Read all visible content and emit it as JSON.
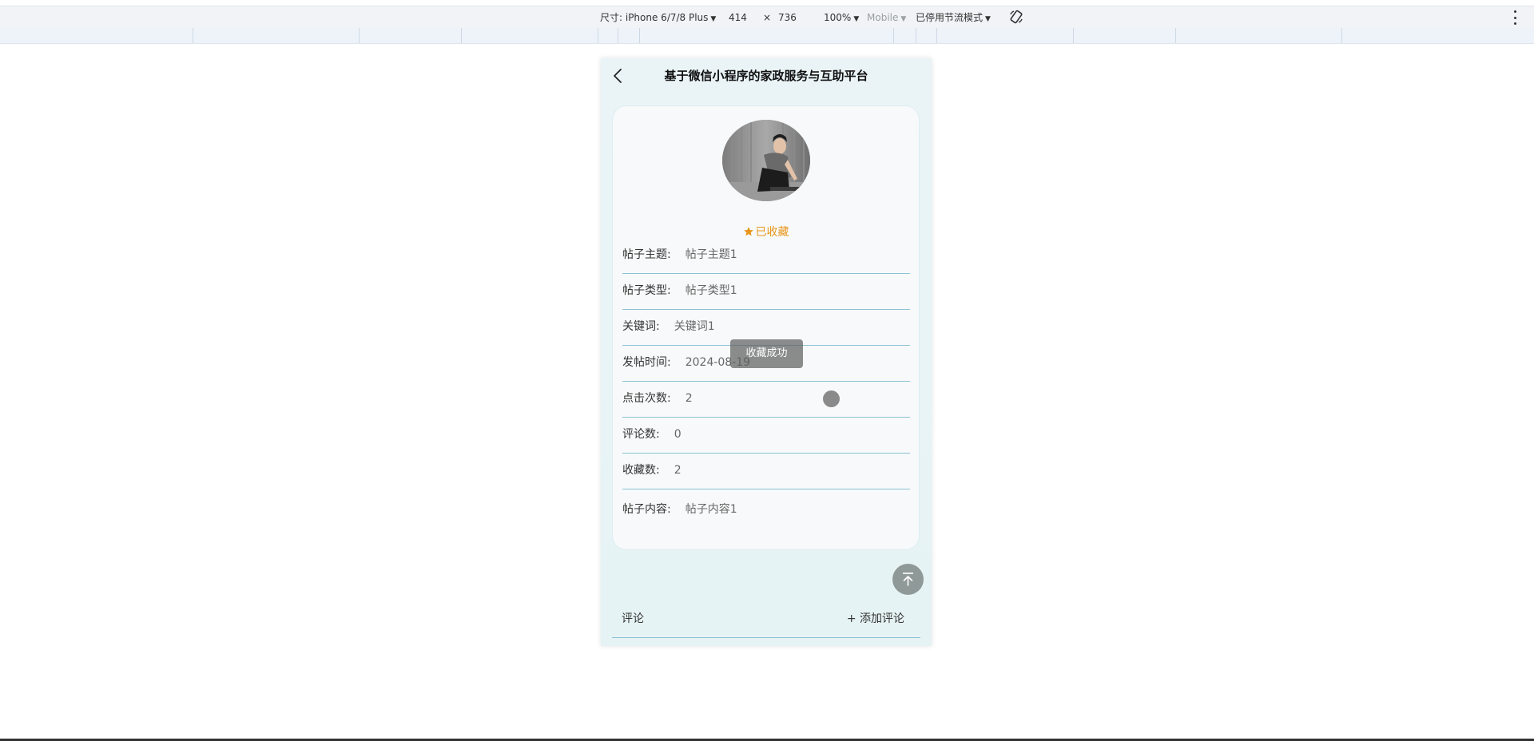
{
  "devtools": {
    "device_label": "尺寸: iPhone 6/7/8 Plus",
    "width": "414",
    "times": "×",
    "height": "736",
    "zoom": "100%",
    "mode": "Mobile",
    "throttle": "已停用节流模式"
  },
  "app": {
    "title": "基于微信小程序的家政服务与互助平台",
    "favorite_status": "已收藏",
    "fields": [
      {
        "label": "帖子主题:",
        "value": "帖子主题1"
      },
      {
        "label": "帖子类型:",
        "value": "帖子类型1"
      },
      {
        "label": "关键词:",
        "value": "关键词1"
      },
      {
        "label": "发帖时间:",
        "value": "2024-08-19"
      },
      {
        "label": "点击次数:",
        "value": "2"
      },
      {
        "label": "评论数:",
        "value": "0"
      },
      {
        "label": "收藏数:",
        "value": "2"
      },
      {
        "label": "帖子内容:",
        "value": "帖子内容1"
      }
    ],
    "toast": "收藏成功",
    "comments": {
      "label": "评论",
      "add_label": "+ 添加评论"
    }
  },
  "colors": {
    "accent": "#e8961a",
    "divider": "#8cc3d3",
    "phone_bg": "#e6f3f4"
  }
}
